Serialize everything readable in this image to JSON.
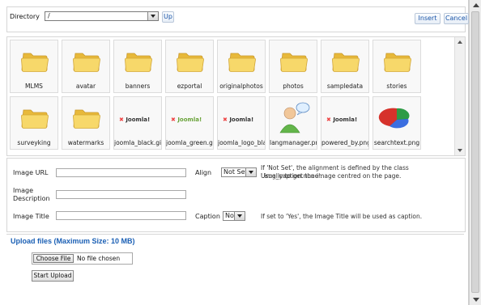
{
  "toolbar": {
    "directory_label": "Directory",
    "directory_value": "/",
    "up_label": "Up",
    "insert_label": "Insert",
    "cancel_label": "Cancel"
  },
  "files": [
    {
      "name": "MLMS",
      "icon": "folder-icon"
    },
    {
      "name": "avatar",
      "icon": "folder-icon"
    },
    {
      "name": "banners",
      "icon": "folder-icon"
    },
    {
      "name": "ezportal",
      "icon": "folder-icon"
    },
    {
      "name": "originalphotos",
      "icon": "folder-icon"
    },
    {
      "name": "photos",
      "icon": "folder-icon"
    },
    {
      "name": "sampledata",
      "icon": "folder-icon"
    },
    {
      "name": "stories",
      "icon": "folder-icon"
    },
    {
      "name": "surveyking",
      "icon": "folder-icon"
    },
    {
      "name": "watermarks",
      "icon": "folder-icon"
    },
    {
      "name": "joomla_black.gif",
      "icon": "joomla-logo-thumb",
      "logo_text": "Joomla!"
    },
    {
      "name": "joomla_green.gif",
      "icon": "joomla-logo-thumb",
      "logo_text": "Joomla!"
    },
    {
      "name": "joomla_logo_blac",
      "icon": "joomla-logo-thumb",
      "logo_text": "Joomla!"
    },
    {
      "name": "langmanager.png",
      "icon": "user-speech-icon"
    },
    {
      "name": "powered_by.png",
      "icon": "joomla-logo-thumb",
      "logo_text": "Joomla!"
    },
    {
      "name": "searchtext.png",
      "icon": "pie-chart-icon"
    }
  ],
  "form": {
    "image_url_label": "Image URL",
    "image_description_label": "Image\nDescription",
    "image_title_label": "Image Title",
    "align_label": "Align",
    "align_value": "Not Set",
    "align_note_1": "If 'Not Set', the alignment is defined by the class '.img_caption.none'.",
    "align_note_2": "Usually to get the image centred on the page.",
    "caption_label": "Caption",
    "caption_value": "No",
    "caption_note": "If set to 'Yes', the Image Title will be used as caption."
  },
  "upload": {
    "title": "Upload files (Maximum Size: 10 MB)",
    "choose_label": "Choose File",
    "no_file_text": "No file chosen",
    "start_label": "Start Upload"
  },
  "colors": {
    "accent_blue": "#1a5fb4",
    "folder_yellow": "#f2cf5e"
  }
}
